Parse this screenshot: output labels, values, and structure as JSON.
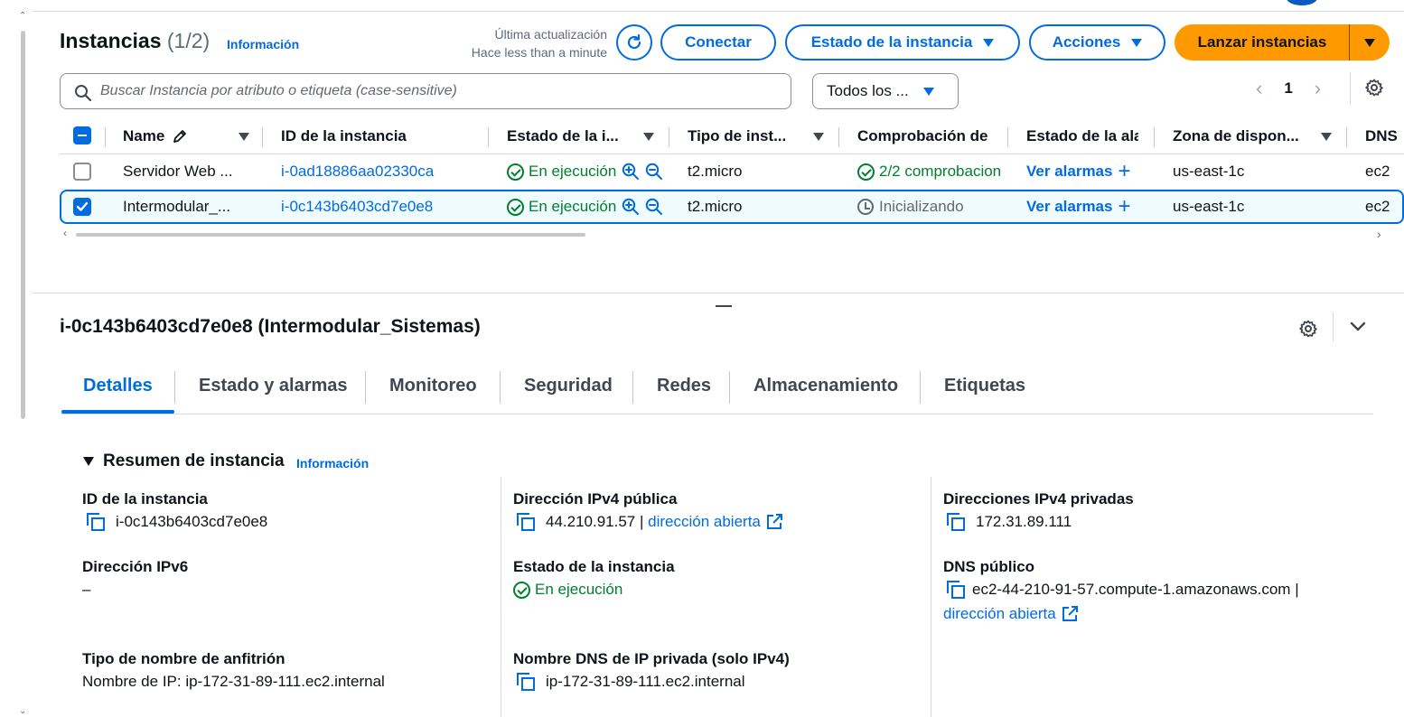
{
  "panel": {
    "title": "Instancias",
    "count": "(1/2)",
    "info_link": "Información",
    "last_update_label": "Última actualización",
    "last_update_value": "Hace less than a minute"
  },
  "toolbar": {
    "connect": "Conectar",
    "instance_state": "Estado de la instancia",
    "actions": "Acciones",
    "launch": "Lanzar instancias"
  },
  "search": {
    "placeholder": "Buscar Instancia por atributo o etiqueta (case-sensitive)"
  },
  "filter": {
    "selected": "Todos los ..."
  },
  "pagination": {
    "page": "1",
    "prev": "‹",
    "next": "›"
  },
  "table": {
    "columns": [
      "Name",
      "ID de la instancia",
      "Estado de la i...",
      "Tipo de inst...",
      "Comprobación de",
      "Estado de la ala",
      "Zona de dispon...",
      "DNS"
    ],
    "rows": [
      {
        "selected": false,
        "name": "Servidor Web ...",
        "id": "i-0ad18886aa02330ca",
        "state": "En ejecución",
        "type": "t2.micro",
        "check": "2/2 comprobacion",
        "check_status": "ok",
        "alarm": "Ver alarmas",
        "zone": "us-east-1c",
        "dns": "ec2"
      },
      {
        "selected": true,
        "name": "Intermodular_...",
        "id": "i-0c143b6403cd7e0e8",
        "state": "En ejecución",
        "type": "t2.micro",
        "check": "Inicializando",
        "check_status": "pending",
        "alarm": "Ver alarmas",
        "zone": "us-east-1c",
        "dns": "ec2"
      }
    ]
  },
  "detail": {
    "title": "i-0c143b6403cd7e0e8 (Intermodular_Sistemas)",
    "tabs": [
      "Detalles",
      "Estado y alarmas",
      "Monitoreo",
      "Seguridad",
      "Redes",
      "Almacenamiento",
      "Etiquetas"
    ],
    "active_tab": "Detalles",
    "summary_title": "Resumen de instancia",
    "summary_info": "Información",
    "fields": {
      "instance_id_label": "ID de la instancia",
      "instance_id_value": "i-0c143b6403cd7e0e8",
      "public_ipv4_label": "Dirección IPv4 pública",
      "public_ipv4_value": "44.210.91.57",
      "open_address": "dirección abierta",
      "private_ipv4_label": "Direcciones IPv4 privadas",
      "private_ipv4_value": "172.31.89.111",
      "ipv6_label": "Dirección IPv6",
      "ipv6_value": "–",
      "state_label": "Estado de la instancia",
      "state_value": "En ejecución",
      "public_dns_label": "DNS público",
      "public_dns_value": "ec2-44-210-91-57.compute-1.amazonaws.com",
      "hostname_type_label": "Tipo de nombre de anfitrión",
      "hostname_type_value": "Nombre de IP: ip-172-31-89-111.ec2.internal",
      "private_dns_label": "Nombre DNS de IP privada (solo IPv4)",
      "private_dns_value": "ip-172-31-89-111.ec2.internal"
    }
  },
  "colors": {
    "accent": "#006ce0",
    "launch": "#ff9900",
    "success": "#00802f",
    "selected_row": "#f0fbff"
  }
}
